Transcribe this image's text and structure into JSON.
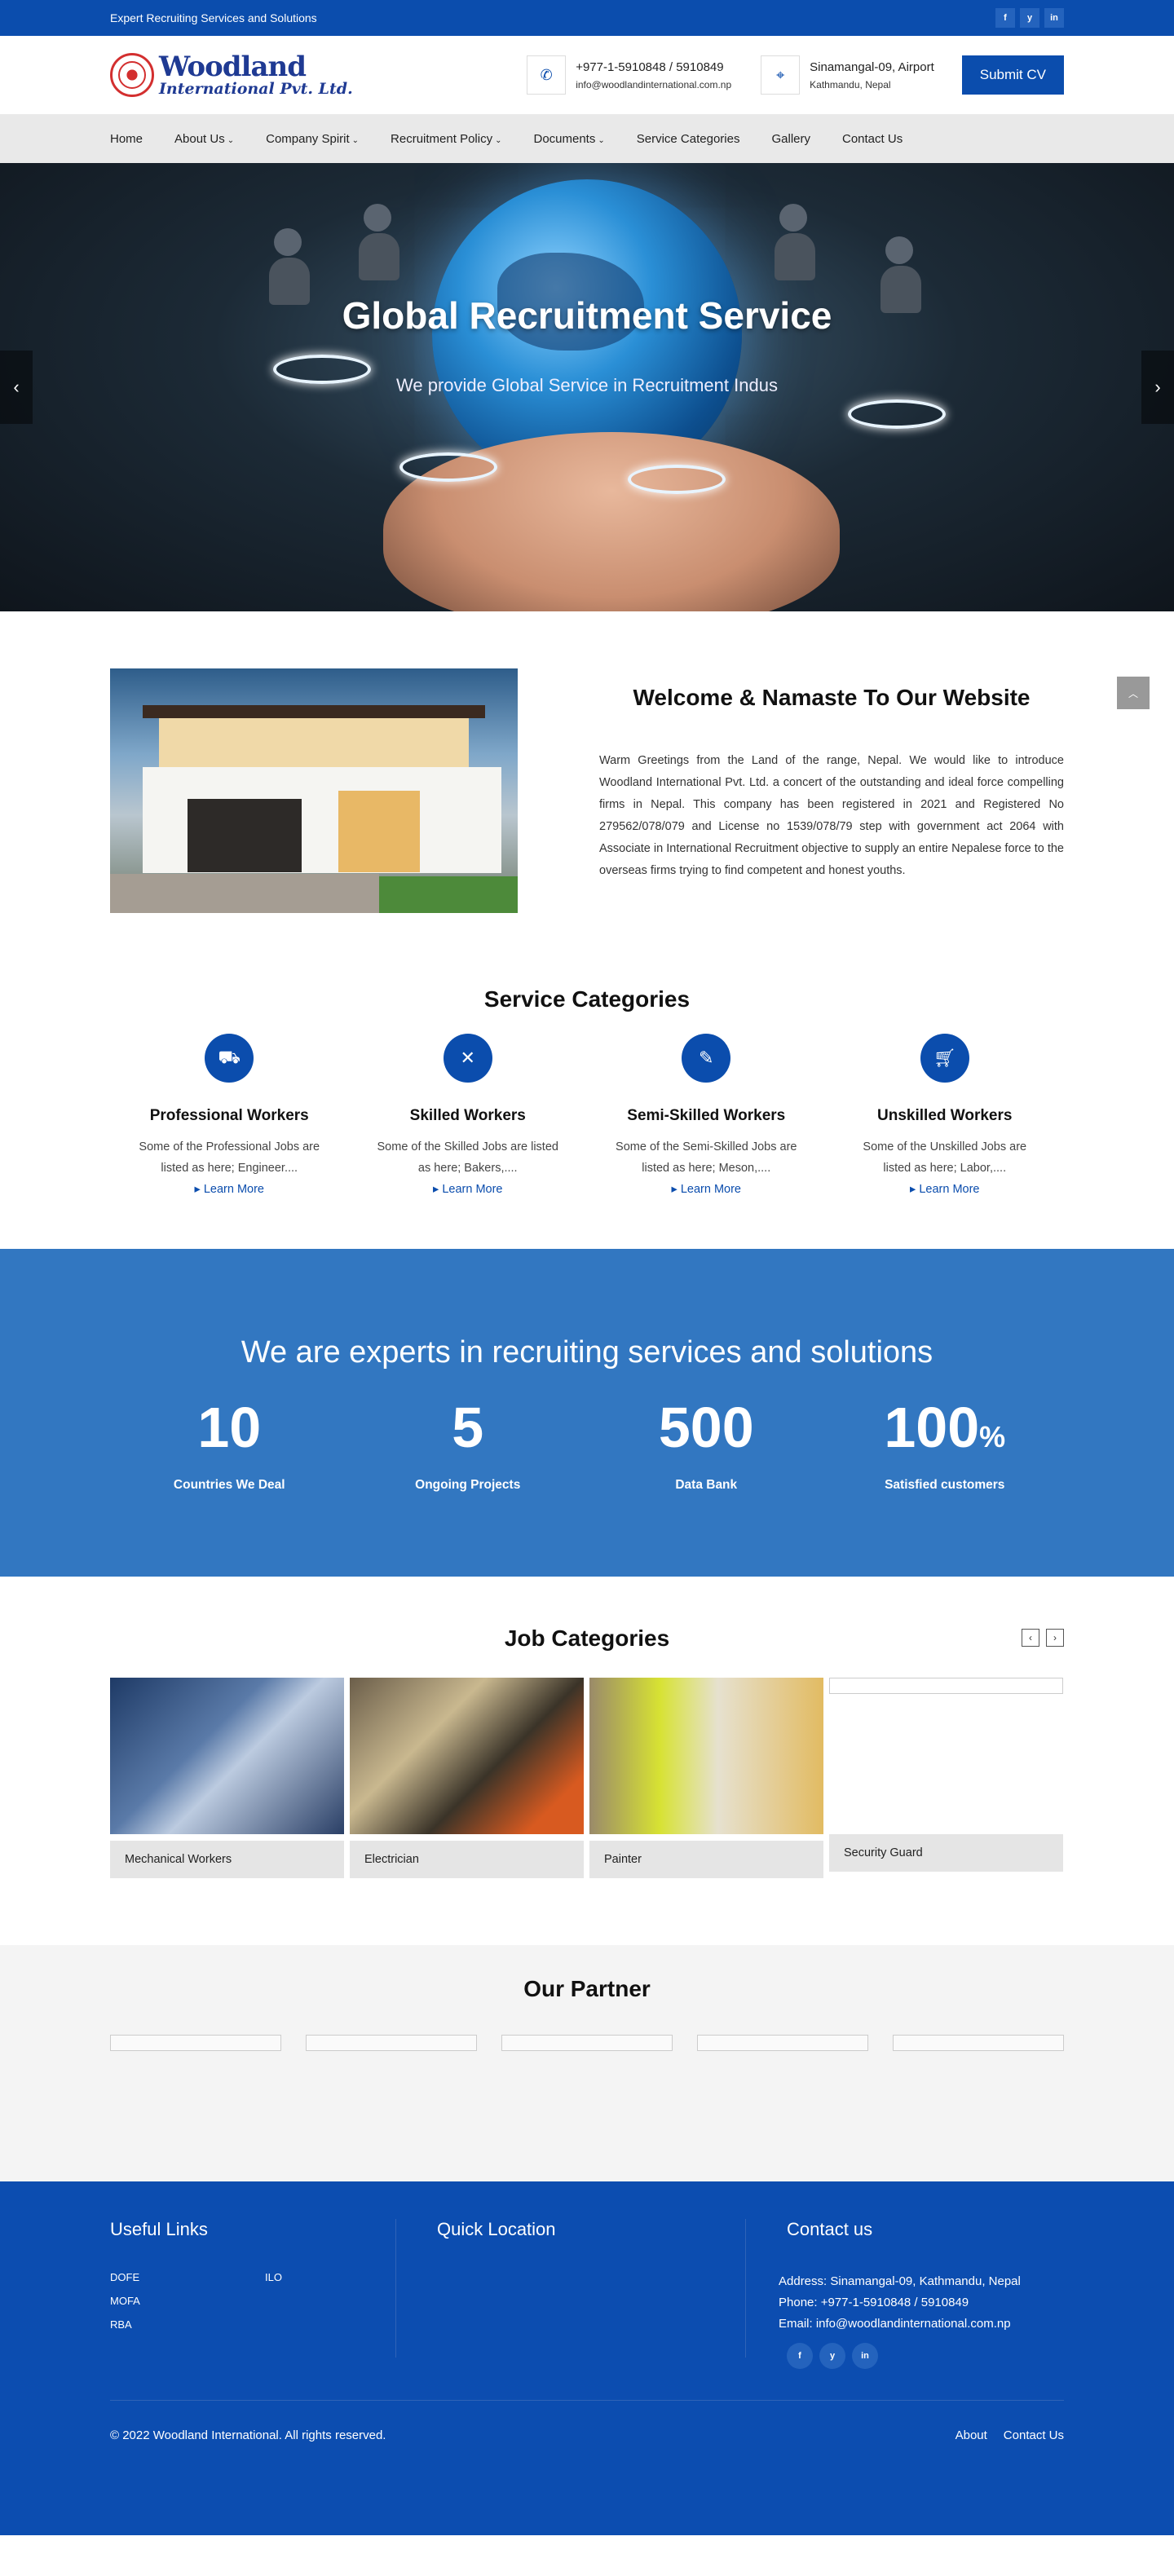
{
  "topbar": {
    "tagline": "Expert Recruiting Services and Solutions",
    "socials": [
      "f",
      "y",
      "in"
    ]
  },
  "header": {
    "logo_line1": "Woodland",
    "logo_line2": "International Pvt. Ltd.",
    "phone": "+977-1-5910848 / 5910849",
    "email": "info@woodlandinternational.com.np",
    "address_line1": "Sinamangal-09, Airport",
    "address_line2": "Kathmandu, Nepal",
    "submit_cv": "Submit CV"
  },
  "nav": [
    {
      "label": "Home",
      "caret": ""
    },
    {
      "label": "About Us",
      "caret": "⌄"
    },
    {
      "label": "Company Spirit",
      "caret": "⌄"
    },
    {
      "label": "Recruitment Policy",
      "caret": "⌄"
    },
    {
      "label": "Documents",
      "caret": "⌄"
    },
    {
      "label": "Service Categories",
      "caret": ""
    },
    {
      "label": "Gallery",
      "caret": ""
    },
    {
      "label": "Contact Us",
      "caret": ""
    }
  ],
  "hero": {
    "title": "Global Recruitment Service",
    "subtitle": "We provide Global Service in Recruitment Indus"
  },
  "welcome": {
    "title": "Welcome & Namaste To Our Website",
    "text": "Warm Greetings from the Land of the range, Nepal. We would like to introduce Woodland International Pvt. Ltd. a concert of the outstanding and ideal force compelling firms in Nepal. This company has been registered in 2021 and Registered No 279562/078/079 and License no 1539/078/79 step with government act 2064 with Associate in International Recruitment objective to supply an entire Nepalese force to the overseas firms trying to find competent and honest youths."
  },
  "services": {
    "title": "Service Categories",
    "items": [
      {
        "title": "Professional Workers",
        "desc": "Some of the Professional Jobs are listed as here; Engineer....",
        "link": "Learn More",
        "icon": "truck-icon"
      },
      {
        "title": "Skilled Workers",
        "desc": "Some of the Skilled Jobs are listed as here; Bakers,....",
        "link": "Learn More",
        "icon": "utensils-icon"
      },
      {
        "title": "Semi-Skilled Workers",
        "desc": "Some of the Semi-Skilled Jobs are listed as here; Meson,....",
        "link": "Learn More",
        "icon": "brush-icon"
      },
      {
        "title": "Unskilled Workers",
        "desc": "Some of the Unskilled Jobs are listed as here; Labor,....",
        "link": "Learn More",
        "icon": "cart-icon"
      }
    ]
  },
  "stats": {
    "title": "We are experts in recruiting services and solutions",
    "items": [
      {
        "num": "10",
        "suffix": "",
        "label": "Countries We Deal"
      },
      {
        "num": "5",
        "suffix": "",
        "label": "Ongoing Projects"
      },
      {
        "num": "500",
        "suffix": "",
        "label": "Data Bank"
      },
      {
        "num": "100",
        "suffix": "%",
        "label": "Satisfied customers"
      }
    ]
  },
  "jobs": {
    "title": "Job Categories",
    "items": [
      "Mechanical Workers",
      "Electrician",
      "Painter",
      "Security Guard"
    ]
  },
  "partners": {
    "title": "Our Partner"
  },
  "footer": {
    "links_title": "Useful Links",
    "links": [
      "DOFE",
      "ILO",
      "MOFA",
      "",
      "RBA"
    ],
    "location_title": "Quick Location",
    "contact_title": "Contact us",
    "address": "Address: Sinamangal-09, Kathmandu, Nepal",
    "phone": "Phone: +977-1-5910848 / 5910849",
    "email": "Email: info@woodlandinternational.com.np",
    "copyright": "© 2022 Woodland International. All rights reserved.",
    "bottom_links": [
      "About",
      "Contact Us"
    ]
  }
}
